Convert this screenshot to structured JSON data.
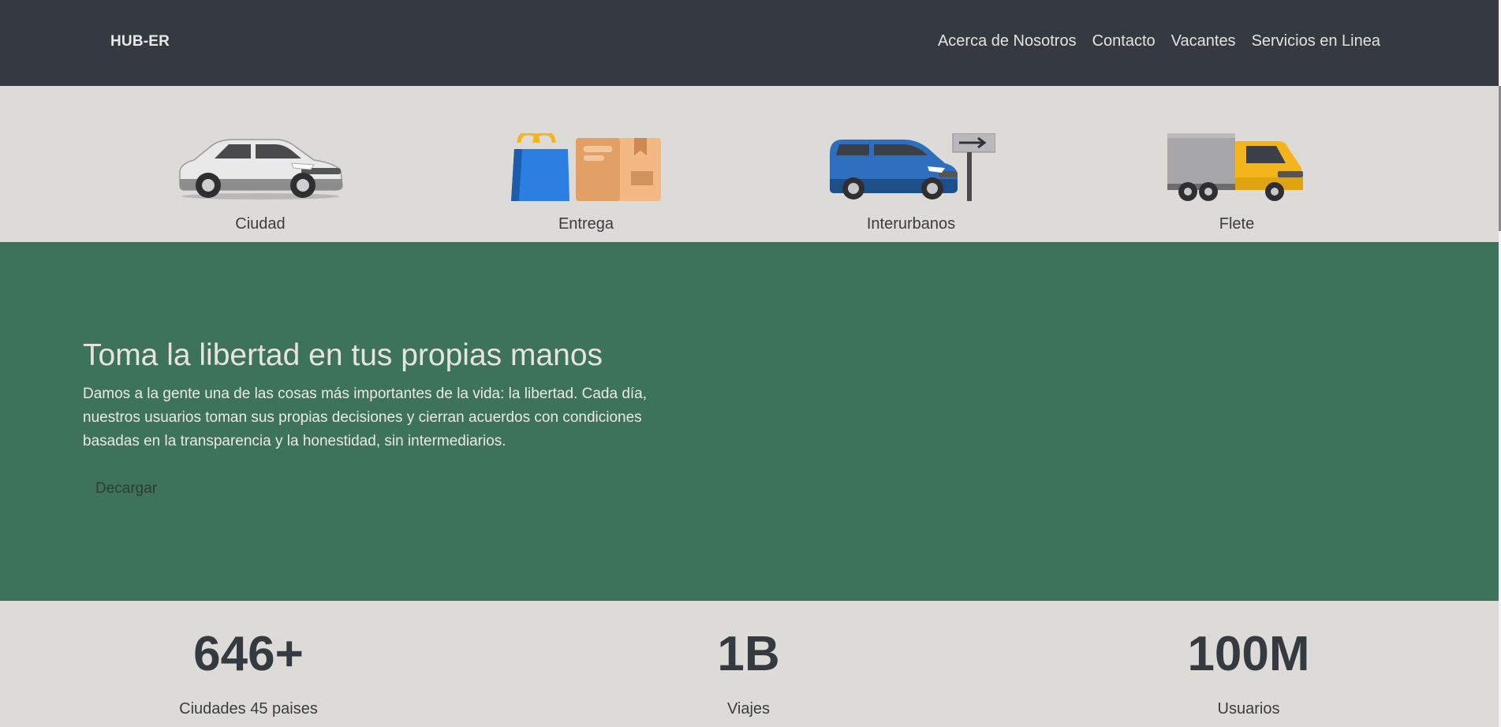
{
  "navbar": {
    "brand": "HUB-ER",
    "links": [
      {
        "label": "Acerca de Nosotros"
      },
      {
        "label": "Contacto"
      },
      {
        "label": "Vacantes"
      },
      {
        "label": "Servicios en Linea"
      }
    ],
    "background": "#343a40"
  },
  "services": [
    {
      "label": "Ciudad",
      "icon": "car-icon"
    },
    {
      "label": "Entrega",
      "icon": "delivery-icon"
    },
    {
      "label": "Interurbanos",
      "icon": "van-icon"
    },
    {
      "label": "Flete",
      "icon": "truck-icon"
    }
  ],
  "hero": {
    "title": "Toma la libertad en tus propias manos",
    "text": "Damos a la gente una de las cosas más importantes de la vida: la libertad. Cada día, nuestros usuarios toman sus propias decisiones y cierran acuerdos con condiciones basadas en la transparencia y la honestidad, sin intermediarios.",
    "button": "Decargar",
    "background": "#3d735a"
  },
  "stats": [
    {
      "value": "646+",
      "label": "Ciudades 45 paises"
    },
    {
      "value": "1B",
      "label": "Viajes"
    },
    {
      "value": "100M",
      "label": "Usuarios"
    }
  ]
}
